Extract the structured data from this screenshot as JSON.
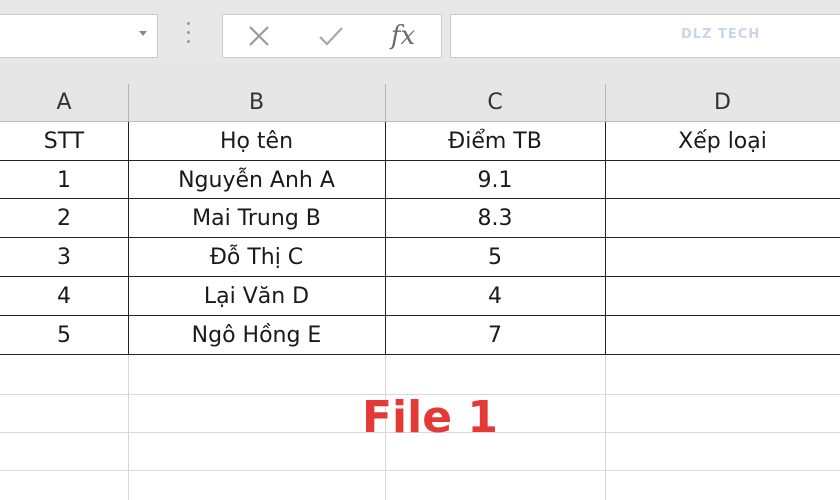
{
  "formula_bar": {
    "name_box_value": "",
    "cancel_icon": "close-icon",
    "enter_icon": "check-icon",
    "fx_label": "fx",
    "formula_value": "",
    "watermark": "DLZ TECH"
  },
  "sheet": {
    "columns": [
      "A",
      "B",
      "C",
      "D"
    ],
    "header_row": [
      "STT",
      "Họ tên",
      "Điểm TB",
      "Xếp loại"
    ],
    "rows": [
      [
        "1",
        "Nguyễn Anh A",
        "9.1",
        ""
      ],
      [
        "2",
        "Mai Trung B",
        "8.3",
        ""
      ],
      [
        "3",
        "Đỗ Thị C",
        "5",
        ""
      ],
      [
        "4",
        "Lại Văn D",
        "4",
        ""
      ],
      [
        "5",
        "Ngô Hồng E",
        "7",
        ""
      ]
    ]
  },
  "caption": "File 1",
  "colors": {
    "caption": "#e53935",
    "header_bg": "#e6e6e6",
    "toolbar_bg": "#e8e8e8"
  }
}
